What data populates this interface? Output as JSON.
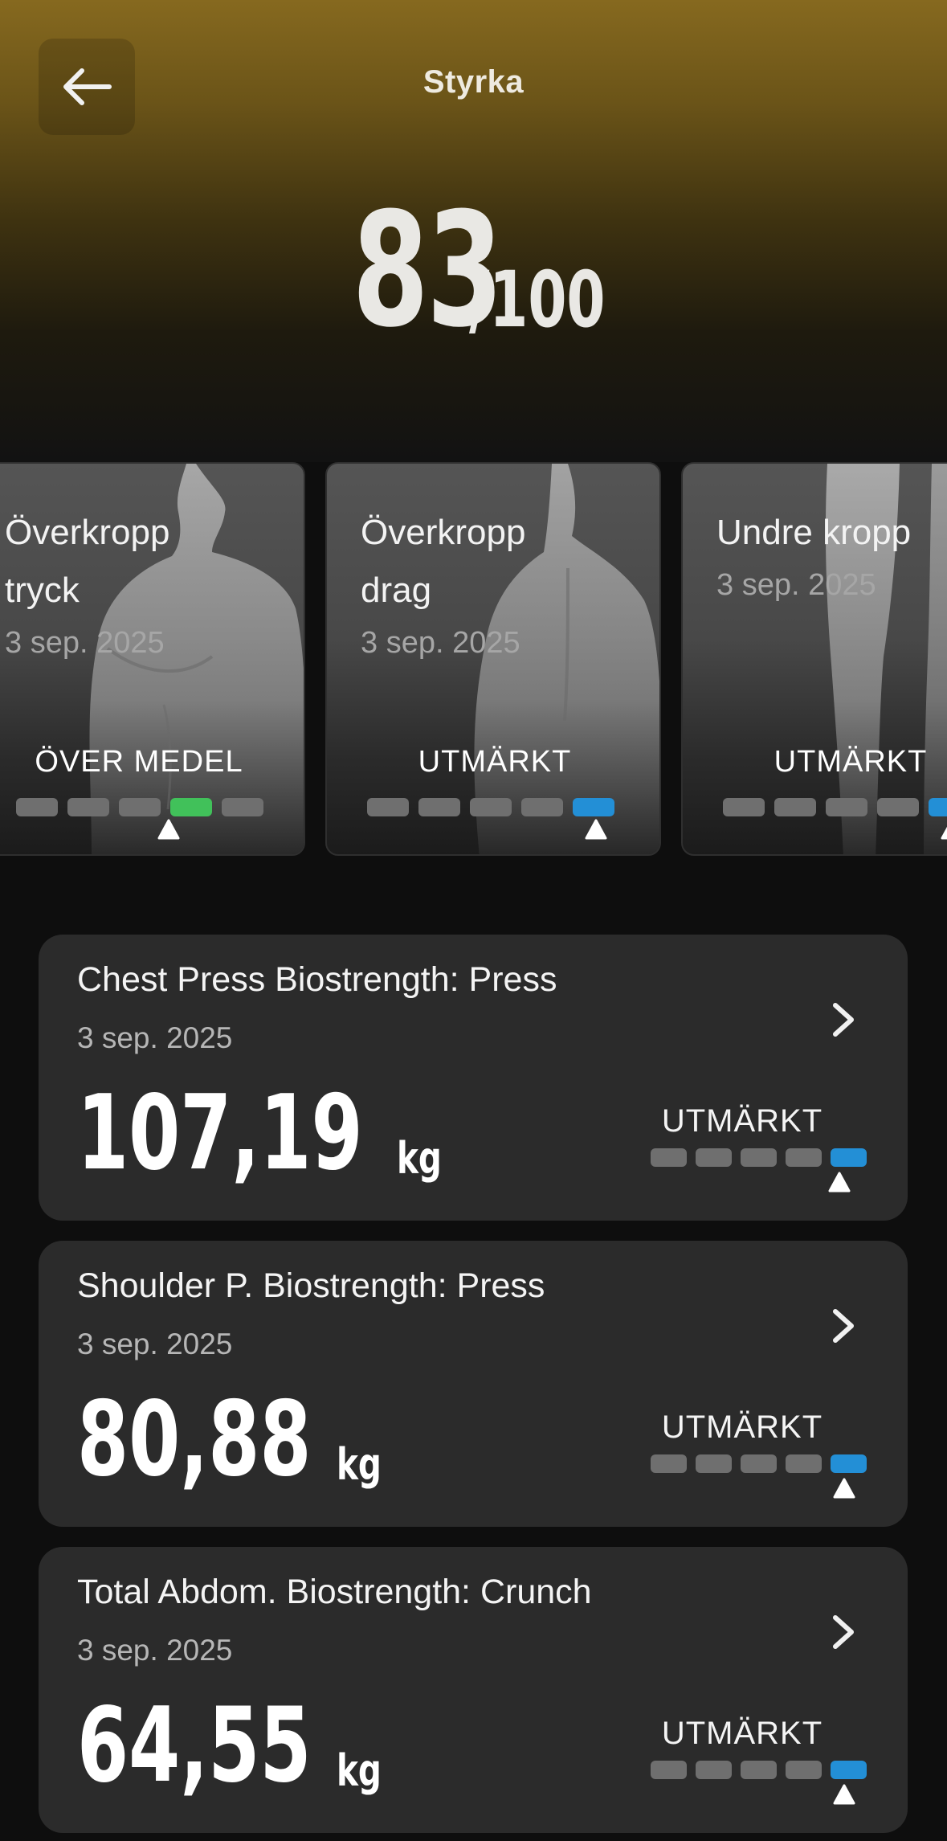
{
  "header": {
    "title": "Styrka",
    "score": "83",
    "score_max": "/100"
  },
  "categories": [
    {
      "title_line1": "Överkropp",
      "title_line2": "tryck",
      "date": "3 sep. 2025",
      "rating": "ÖVER MEDEL",
      "level_of_5": 4,
      "color": "#41c15a"
    },
    {
      "title_line1": "Överkropp",
      "title_line2": "drag",
      "date": "3 sep. 2025",
      "rating": "UTMÄRKT",
      "level_of_5": 5,
      "color": "#238fd6"
    },
    {
      "title_line1": "Undre kropp",
      "title_line2": "",
      "date": "3 sep. 2025",
      "rating": "UTMÄRKT",
      "level_of_5": 5,
      "color": "#238fd6"
    }
  ],
  "exercises": [
    {
      "name": "Chest Press Biostrength: Press",
      "date": "3 sep. 2025",
      "value": "107,19",
      "unit": "kg",
      "rating": "UTMÄRKT",
      "level_of_5": 5
    },
    {
      "name": "Shoulder P. Biostrength: Press",
      "date": "3 sep. 2025",
      "value": "80,88",
      "unit": "kg",
      "rating": "UTMÄRKT",
      "level_of_5": 5
    },
    {
      "name": "Total Abdom. Biostrength: Crunch",
      "date": "3 sep. 2025",
      "value": "64,55",
      "unit": "kg",
      "rating": "UTMÄRKT",
      "level_of_5": 5
    }
  ],
  "icons": {
    "back": "arrow-left-icon",
    "chevron": "chevron-right-icon",
    "pointer": "triangle-up-icon"
  },
  "colors": {
    "hero_top": "#86691f",
    "excellent": "#238fd6",
    "above_average": "#41c15a",
    "card_bg": "#2b2b2b"
  }
}
